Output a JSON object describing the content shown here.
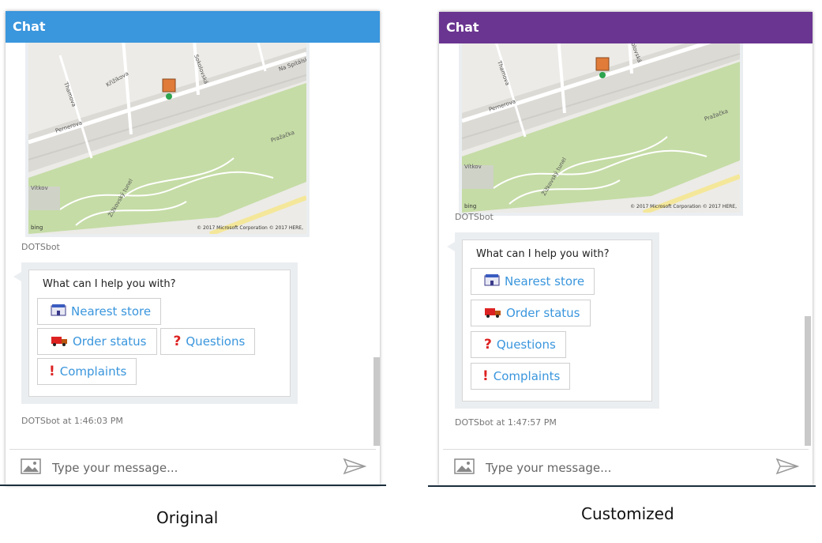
{
  "left": {
    "header_title": "Chat",
    "header_color": "#3a96dd",
    "map_copyright": "© 2017 Microsoft Corporation © 2017 HERE,",
    "map_brand": "bing",
    "map_sender": "DOTSbot",
    "prompt": "What can I help you with?",
    "buttons": [
      {
        "label": "Nearest store",
        "icon": "store-icon"
      },
      {
        "label": "Order status",
        "icon": "truck-icon"
      },
      {
        "label": "Questions",
        "icon": "question-icon"
      },
      {
        "label": "Complaints",
        "icon": "exclamation-icon"
      }
    ],
    "timestamp": "DOTSbot at 1:46:03 PM",
    "input_placeholder": "Type your message...",
    "caption": "Original"
  },
  "right": {
    "header_title": "Chat",
    "header_color": "#6a3591",
    "map_copyright": "© 2017 Microsoft Corporation © 2017 HERE,",
    "map_brand": "bing",
    "map_sender": "DOTSbot",
    "prompt": "What can I help you with?",
    "buttons": [
      {
        "label": "Nearest store",
        "icon": "store-icon"
      },
      {
        "label": "Order status",
        "icon": "truck-icon"
      },
      {
        "label": "Questions",
        "icon": "question-icon"
      },
      {
        "label": "Complaints",
        "icon": "exclamation-icon"
      }
    ],
    "timestamp": "DOTSbot at 1:47:57 PM",
    "input_placeholder": "Type your message...",
    "caption": "Customized"
  },
  "map_labels": {
    "street1": "Thamova",
    "street2": "Křižíkova",
    "street3": "Sokolovská",
    "street4": "Na Spitálsku",
    "street5": "Pernerova",
    "street6": "Pražačka",
    "street7": "Vítkov",
    "street8": "Žižkovský tunel"
  }
}
